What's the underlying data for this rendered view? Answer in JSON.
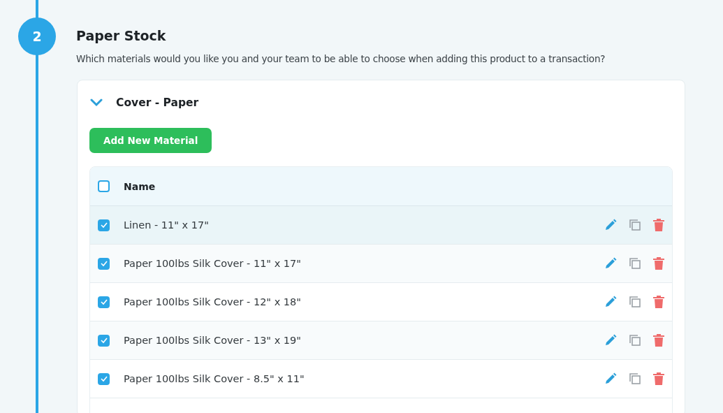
{
  "step": {
    "number": "2",
    "title": "Paper Stock",
    "description": "Which materials would you like you and your team to be able to choose when adding this product to a transaction?"
  },
  "section": {
    "title": "Cover - Paper",
    "expanded": true,
    "add_button": "Add New Material",
    "table": {
      "columns": [
        "Name"
      ],
      "select_all_checked": false,
      "rows": [
        {
          "name": "Linen - 11\" x 17\"",
          "checked": true,
          "hovered": true
        },
        {
          "name": "Paper 100lbs Silk Cover - 11\" x 17\"",
          "checked": true,
          "hovered": false
        },
        {
          "name": "Paper 100lbs Silk Cover - 12\" x 18\"",
          "checked": true,
          "hovered": false
        },
        {
          "name": "Paper 100lbs Silk Cover - 13\" x 19\"",
          "checked": true,
          "hovered": false
        },
        {
          "name": "Paper 100lbs Silk Cover - 8.5\" x 11\"",
          "checked": true,
          "hovered": false
        }
      ]
    }
  }
}
